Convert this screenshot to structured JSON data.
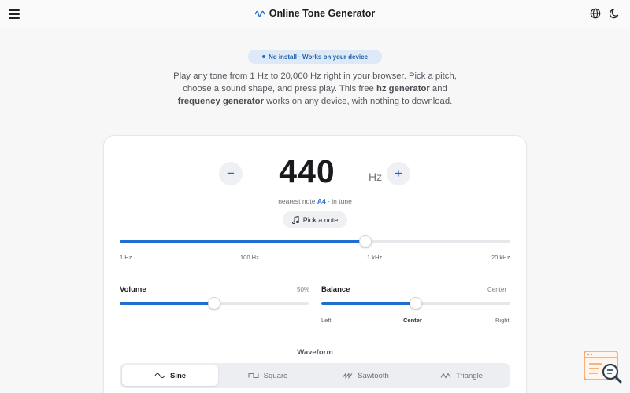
{
  "colors": {
    "accent": "#1f6fd0",
    "background": "#f7f7f8",
    "card": "#ffffff",
    "button_bg": "#eef0f3",
    "badge_orange": "#f0a060"
  },
  "header": {
    "title": "Online Tone Generator",
    "logo_icon": "wave-icon",
    "menu_icon": "hamburger-menu-icon",
    "language_icon": "globe-icon",
    "theme_icon": "moon-icon"
  },
  "hero": {
    "badge": "No install · Works on your device",
    "intro_part1": "Play any tone from 1 Hz to 20,000 Hz right in your browser. Pick a pitch, choose a sound shape, and press play. This free ",
    "intro_bold1": "hz generator",
    "intro_part2": " and ",
    "intro_bold2": "frequency generator",
    "intro_part3": " works on any device, with nothing to download."
  },
  "frequency": {
    "value": "440",
    "unit": "Hz",
    "decrement_label": "−",
    "increment_label": "+",
    "nearest_prefix": "nearest note",
    "nearest_note": "A4",
    "tuning_status": "· in tune",
    "pick_note_label": "Pick a note",
    "pick_note_icon": "music-note-icon",
    "slider_position": 0.63,
    "slider_ticks": [
      "1 Hz",
      "100 Hz",
      "1 kHz",
      "20 kHz"
    ]
  },
  "volume": {
    "label": "Volume",
    "value_text": "50%",
    "level": 0.5
  },
  "balance": {
    "label": "Balance",
    "value_text": "Center",
    "level": 0.5,
    "left_label": "Left",
    "center_label": "Center",
    "right_label": "Right"
  },
  "waveform": {
    "title": "Waveform",
    "selected": "Sine",
    "options": [
      {
        "label": "Sine",
        "icon": "sine-wave-icon"
      },
      {
        "label": "Square",
        "icon": "square-wave-icon"
      },
      {
        "label": "Sawtooth",
        "icon": "sawtooth-wave-icon"
      },
      {
        "label": "Triangle",
        "icon": "triangle-wave-icon"
      }
    ]
  },
  "corner_badge": {
    "icon": "search-page-icon"
  }
}
